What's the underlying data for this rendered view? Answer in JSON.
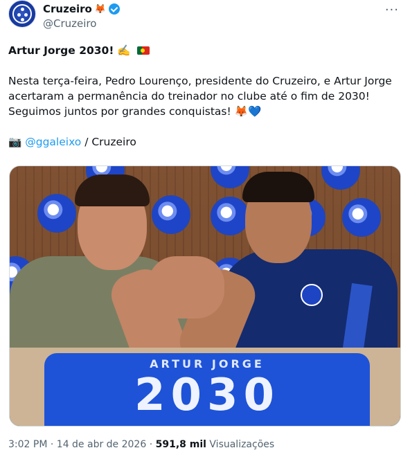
{
  "author": {
    "name": "Cruzeiro",
    "name_emoji": "🦊",
    "handle": "@Cruzeiro",
    "verified": true
  },
  "tweet": {
    "headline": "Artur Jorge 2030!",
    "headline_emoji": "✍️",
    "body_line1": "Nesta terça-feira, Pedro Lourenço, presidente do Cruzeiro, e Artur Jorge",
    "body_line2": "acertaram a permanência do treinador no clube até o fim de 2030!",
    "body_line3": "Seguimos juntos por grandes conquistas!",
    "body_emojis": "🦊💙",
    "credit_icon": "📷",
    "credit_link": "@ggaleixo",
    "credit_suffix": " / Cruzeiro"
  },
  "photo": {
    "shirt_name": "ARTUR JORGE",
    "shirt_number": "2030"
  },
  "meta": {
    "time": "3:02 PM",
    "separator1": " · ",
    "date": "14 de abr de 2026",
    "separator2": " · ",
    "views_count": "591,8 mil",
    "views_label": " Visualizações"
  },
  "more_icon": "···",
  "colors": {
    "accent": "#1d9bf0",
    "brand_blue": "#1e53d8",
    "text": "#0f1419",
    "muted": "#536471"
  }
}
